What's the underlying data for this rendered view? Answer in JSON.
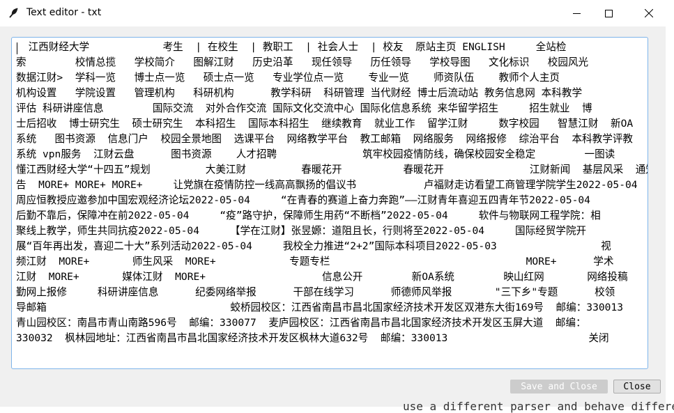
{
  "window": {
    "title": "Text editor - txt"
  },
  "icons": {
    "app": "feather-icon",
    "minimize": "minimize-icon",
    "maximize": "maximize-icon",
    "close": "close-icon"
  },
  "editor": {
    "lines": [
      "  江西财经大学            考生  | 在校生  | 教职工  | 社会人士  | 校友  原站主页 ENGLISH     全站检",
      "索        校情总揽   学校简介   图解江财   历史沿革   现任领导   历任领导   学校导图   文化标识   校园风光",
      "数据江财>  学科一览   博士点一览   硕士点一览   专业学位点一览    专业一览    师资队伍    教师个人主页",
      "机构设置   学院设置   管理机构   科研机构      教学科研  科研管理 当代财经 博士后流动站 教务信息网 本科教学",
      "评估 科研讲座信息        国际交流  对外合作交流 国际文化交流中心 国际化信息系统 来华留学招生     招生就业  博",
      "士后招收  博士研究生  硕士研究生  本科招生  国际本科招生  继续教育  就业工作  留学江财     数字校园   智慧江财  新OA",
      "系统   图书资源  信息门户  校园全景地图  选课平台  网络教学平台  教工邮箱  网络服务  网络报修  综治平台  本科教学评教",
      "系统 vpn服务  江财云盘      图书资源    人才招聘              筑牢校园疫情防线，确保校园安全稳定        一图读",
      "懂江西财经大学“十四五”规划         大美江财         春暖花开          春暖花开              江财新闻  基层风采  通知公",
      "告  MORE+ MORE+ MORE+     让党旗在疫情防控一线高高飘扬的倡议书           卢福财走访看望工商管理学院学生2022-05-04",
      "周应恒教授应邀参加中国宏观经济论坛2022-05-04     “在青春的赛道上奋力奔跑”——江财青年喜迎五四青年节2022-05-04",
      "后勤不靠后，保障冲在前2022-05-04     “疫”路守护，保障师生用药“不断档”2022-05-04     软件与物联网工程学院：相",
      "聚线上教学，师生共同抗疫2022-05-04     【学在江财】张昱嫄：道阻且长，行则将至2022-05-04     国际经贸学院开",
      "展“百年再出发，喜迎二十大”系列活动2022-05-04     我校全力推进“2+2”国际本科项目2022-05-03                 视",
      "频江财  MORE+       师生风采  MORE+            专题专栏                                MORE+      学术",
      "江财  MORE+       媒体江财  MORE+                   信息公开        新OA系统        映山红网       网络投稿       后",
      "勤网上报修     科研讲座信息      纪委网络举报      干部在线学习      师德师风举报       \"三下乡\"专题      校领",
      "导邮箱                              蛟桥园校区：江西省南昌市昌北国家经济技术开发区双港东大街169号  邮编：330013",
      "青山园校区：南昌市青山南路596号  邮编：330077  麦庐园校区：江西省南昌市昌北国家经济技术开发区玉屏大道  邮编：",
      "330032  枫林园地址：江西省南昌市昌北国家经济技术开发区枫林大道632号  邮编：330013                       关闭"
    ]
  },
  "buttons": {
    "save_close": "Save and Close",
    "close": "Close"
  },
  "background": {
    "text": "use a different parser and behave different"
  }
}
